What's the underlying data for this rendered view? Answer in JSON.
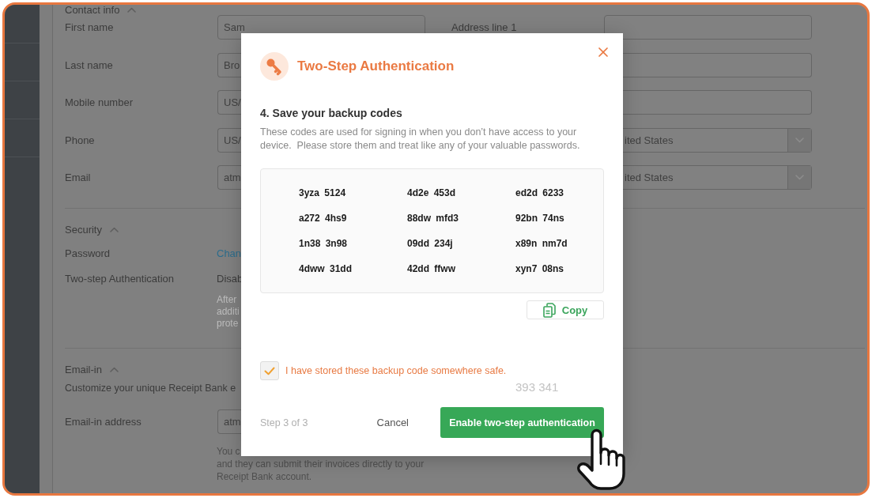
{
  "contact_info": {
    "title": "Contact info",
    "expanded": true,
    "rows": [
      {
        "label": "First name",
        "value": "Sam",
        "right": {
          "kind": "input",
          "label": "Address line 1"
        }
      },
      {
        "label": "Last name",
        "value": "Bro",
        "right": {
          "kind": "input"
        }
      },
      {
        "label": "Mobile number",
        "value": "US/",
        "right": {
          "kind": "input"
        }
      },
      {
        "label": "Phone",
        "value": "US/",
        "right": {
          "kind": "select",
          "value": "ited States"
        }
      },
      {
        "label": "Email",
        "value": "atm",
        "right": {
          "kind": "select",
          "value": "ited States"
        }
      }
    ]
  },
  "security": {
    "title": "Security",
    "expanded": true,
    "rows": [
      {
        "label": "Password",
        "kind": "link",
        "value": "Chan"
      },
      {
        "label": "Two-step Authentication",
        "kind": "text",
        "value": "Disab",
        "note_lines": [
          "After",
          "additi",
          "prote"
        ]
      }
    ]
  },
  "email_in": {
    "title": "Email-in",
    "expanded": true,
    "description": "Customize your unique Receipt Bank e",
    "field_label": "Email-in address",
    "field_value": "atm",
    "hint_lines": [
      "You c",
      "and they can submit their invoices directly to your",
      "Receipt Bank account."
    ]
  },
  "dialog": {
    "title": "Two-Step Authentication",
    "step_heading": "4. Save your backup codes",
    "description": "These codes are used for signing in when you don’t have access to your device.  Please store them and treat like any of your valuable passwords.",
    "backup_codes": [
      "3yza 5124",
      "4d2e 453d",
      "ed2d 6233",
      "a272 4hs9",
      "88dw mfd3",
      "92bn 74ns",
      "1n38 3n98",
      "09dd 234j",
      "x89n nm7d",
      "4dww 31dd",
      "42dd ffww",
      "xyn7 08ns"
    ],
    "copy_button": "Copy",
    "confirmation": {
      "label": "I have stored these backup code somewhere safe.",
      "checked": true
    },
    "faint_number": "393 341",
    "step_indicator": "Step 3 of 3",
    "cancel_button": "Cancel",
    "primary_button": "Enable two-step authentication"
  }
}
